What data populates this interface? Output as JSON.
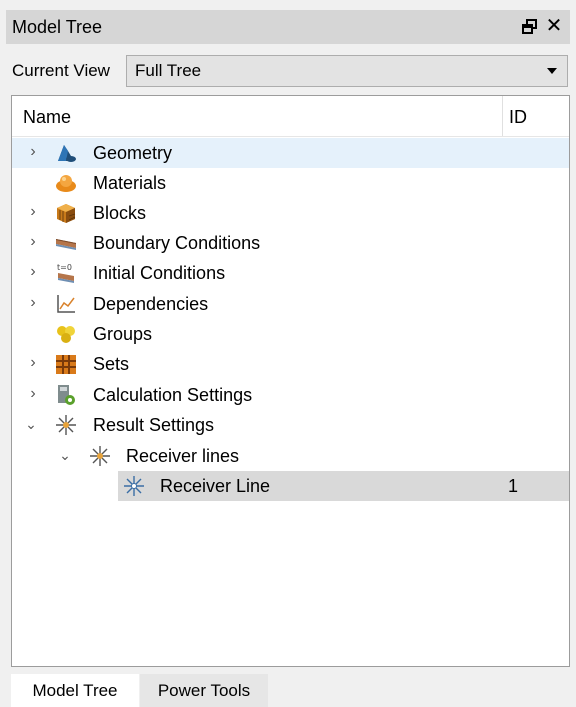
{
  "panel": {
    "title": "Model Tree"
  },
  "view": {
    "label": "Current View",
    "selected": "Full Tree"
  },
  "tree": {
    "columns": {
      "name": "Name",
      "id": "ID"
    },
    "rows": [
      {
        "label": "Geometry",
        "icon": "geometry-icon",
        "expand": "collapsed",
        "level": 0,
        "id": ""
      },
      {
        "label": "Materials",
        "icon": "materials-icon",
        "expand": "none",
        "level": 0,
        "id": ""
      },
      {
        "label": "Blocks",
        "icon": "blocks-icon",
        "expand": "collapsed",
        "level": 0,
        "id": ""
      },
      {
        "label": "Boundary Conditions",
        "icon": "boundary-conditions-icon",
        "expand": "collapsed",
        "level": 0,
        "id": ""
      },
      {
        "label": "Initial Conditions",
        "icon": "initial-conditions-icon",
        "expand": "collapsed",
        "level": 0,
        "id": ""
      },
      {
        "label": "Dependencies",
        "icon": "dependencies-icon",
        "expand": "collapsed",
        "level": 0,
        "id": ""
      },
      {
        "label": "Groups",
        "icon": "groups-icon",
        "expand": "none",
        "level": 0,
        "id": ""
      },
      {
        "label": "Sets",
        "icon": "sets-icon",
        "expand": "collapsed",
        "level": 0,
        "id": ""
      },
      {
        "label": "Calculation Settings",
        "icon": "calculation-settings-icon",
        "expand": "collapsed",
        "level": 0,
        "id": ""
      },
      {
        "label": "Result Settings",
        "icon": "result-settings-icon",
        "expand": "expanded",
        "level": 0,
        "id": ""
      },
      {
        "label": "Receiver lines",
        "icon": "receiver-lines-icon",
        "expand": "expanded",
        "level": 1,
        "id": ""
      },
      {
        "label": "Receiver Line",
        "icon": "receiver-line-icon",
        "expand": "none",
        "level": 2,
        "id": "1"
      }
    ]
  },
  "tabs": [
    {
      "label": "Model Tree",
      "active": true
    },
    {
      "label": "Power Tools",
      "active": false
    }
  ]
}
